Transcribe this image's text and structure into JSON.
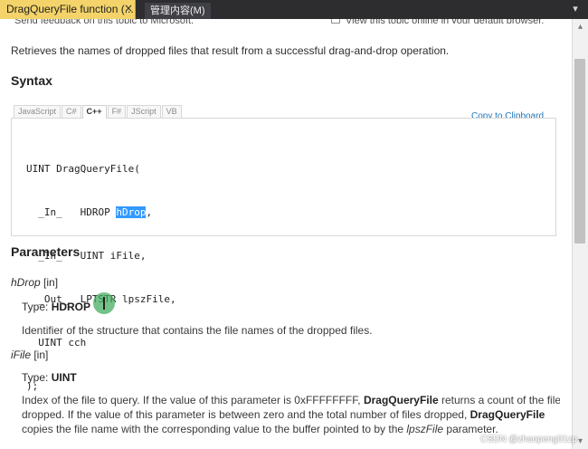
{
  "tabs": {
    "active_title": "DragQueryFile function (...",
    "active_close": "×",
    "inactive_title": "管理内容(M)",
    "right_icon": "▾"
  },
  "top_clip": {
    "left_text": "Send feedback on this topic to Microsoft.",
    "right_text": "View this topic online in your default browser."
  },
  "page": {
    "description": "Retrieves the names of dropped files that result from a successful drag-and-drop operation.",
    "syntax_heading": "Syntax",
    "parameters_heading": "Parameters"
  },
  "syntax": {
    "language_tabs": [
      "JavaScript",
      "C#",
      "C++",
      "F#",
      "JScript",
      "VB"
    ],
    "copy_label": "Copy to Clipboard",
    "code": {
      "line1": "UINT DragQueryFile(",
      "line2_prefix": "  _In_   HDROP ",
      "line2_highlight": "hDrop",
      "line2_suffix": ",",
      "line3": "  _In_   UINT iFile,",
      "line4": "  _Out_  LPTSTR lpszFile,",
      "line5": "  UINT cch",
      "line6": ");"
    }
  },
  "parameters": {
    "hdrop": {
      "name": "hDrop",
      "direction": " [in]",
      "type_label": "Type: ",
      "type_value": "HDROP",
      "description": "Identifier of the structure that contains the file names of the dropped files."
    },
    "ifile": {
      "name": "iFile",
      "direction": " [in]",
      "type_label": "Type: ",
      "type_value": "UINT",
      "description": {
        "line1_part1": "Index of the file to query. If the value of this parameter is 0xFFFFFFFF, ",
        "line1_bold": "DragQueryFile",
        "line1_part2": " returns a count of the files",
        "line2_part1": "dropped. If the value of this parameter is between zero and the total number of files dropped, ",
        "line2_bold": "DragQueryFile",
        "line3_part1": "copies the file name with the corresponding value to the buffer pointed to by the ",
        "line3_italic": "lpszFile",
        "line3_part2": " parameter."
      }
    }
  },
  "watermark": "CSDN @zhaopeng01zp"
}
